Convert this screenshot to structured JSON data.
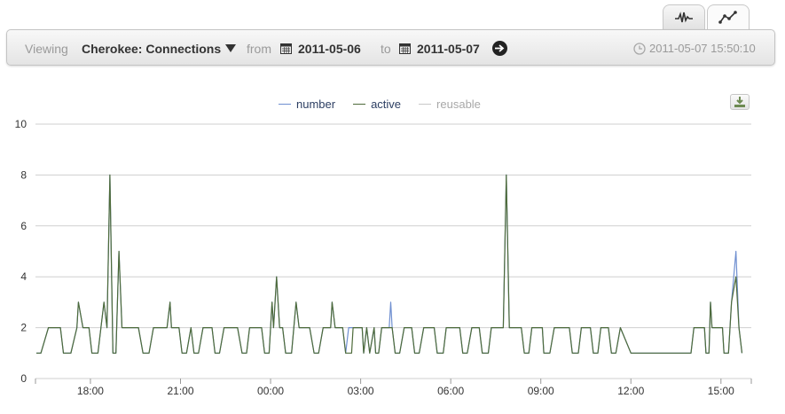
{
  "tabs": [
    {
      "name": "sparkline-tab",
      "icon": "sparkline-icon",
      "active": false
    },
    {
      "name": "line-graph-tab",
      "icon": "line-graph-icon",
      "active": true
    }
  ],
  "toolbar": {
    "viewing_label": "Viewing",
    "source": "Cherokee: Connections",
    "from_label": "from",
    "from_date": "2011-05-06",
    "to_label": "to",
    "to_date": "2011-05-07",
    "timestamp": "2011-05-07 15:50:10"
  },
  "colors": {
    "number": "#6f8fd0",
    "active": "#4e6b3a",
    "reusable": "#c8c8c8",
    "grid": "#cfcfcf"
  },
  "chart_data": {
    "type": "line",
    "ylim": [
      0,
      10
    ],
    "y_ticks": [
      "0",
      "2",
      "4",
      "6",
      "8",
      "10"
    ],
    "x_ticks": [
      "18:00",
      "21:00",
      "00:00",
      "03:00",
      "06:00",
      "09:00",
      "12:00",
      "15:00"
    ],
    "x_tick_hours": [
      18,
      21,
      24,
      27,
      30,
      33,
      36,
      39
    ],
    "x_range_hours": [
      16.17,
      40.01
    ],
    "legend": [
      "number",
      "active",
      "reusable"
    ],
    "active_points": [
      [
        16.2,
        1
      ],
      [
        16.35,
        1
      ],
      [
        16.6,
        2
      ],
      [
        17.0,
        2
      ],
      [
        17.1,
        1
      ],
      [
        17.35,
        1
      ],
      [
        17.55,
        2
      ],
      [
        17.6,
        3
      ],
      [
        17.75,
        2
      ],
      [
        17.95,
        2
      ],
      [
        18.05,
        1
      ],
      [
        18.25,
        1
      ],
      [
        18.35,
        2
      ],
      [
        18.45,
        3
      ],
      [
        18.55,
        2
      ],
      [
        18.65,
        8
      ],
      [
        18.75,
        1
      ],
      [
        18.85,
        1
      ],
      [
        18.95,
        5
      ],
      [
        19.05,
        2
      ],
      [
        19.6,
        2
      ],
      [
        19.75,
        1
      ],
      [
        19.95,
        1
      ],
      [
        20.1,
        2
      ],
      [
        20.55,
        2
      ],
      [
        20.65,
        3
      ],
      [
        20.7,
        2
      ],
      [
        20.95,
        2
      ],
      [
        21.05,
        1
      ],
      [
        21.2,
        1
      ],
      [
        21.35,
        2
      ],
      [
        21.45,
        1
      ],
      [
        21.6,
        1
      ],
      [
        21.75,
        2
      ],
      [
        22.05,
        2
      ],
      [
        22.15,
        1
      ],
      [
        22.3,
        1
      ],
      [
        22.45,
        2
      ],
      [
        22.9,
        2
      ],
      [
        23.05,
        1
      ],
      [
        23.2,
        1
      ],
      [
        23.3,
        2
      ],
      [
        23.7,
        2
      ],
      [
        23.8,
        1
      ],
      [
        23.95,
        1
      ],
      [
        24.05,
        3
      ],
      [
        24.1,
        2
      ],
      [
        24.2,
        4
      ],
      [
        24.3,
        2
      ],
      [
        24.4,
        2
      ],
      [
        24.5,
        1
      ],
      [
        24.7,
        1
      ],
      [
        24.85,
        3
      ],
      [
        24.95,
        2
      ],
      [
        25.3,
        2
      ],
      [
        25.45,
        1
      ],
      [
        25.6,
        1
      ],
      [
        25.75,
        2
      ],
      [
        26.0,
        2
      ],
      [
        26.05,
        3
      ],
      [
        26.15,
        2
      ],
      [
        26.4,
        2
      ],
      [
        26.5,
        1
      ],
      [
        26.7,
        1
      ],
      [
        26.75,
        2
      ],
      [
        27.05,
        2
      ],
      [
        27.1,
        1
      ],
      [
        27.2,
        2
      ],
      [
        27.3,
        1
      ],
      [
        27.45,
        2
      ],
      [
        27.5,
        1
      ],
      [
        27.6,
        1
      ],
      [
        27.7,
        2
      ],
      [
        28.05,
        2
      ],
      [
        28.15,
        1
      ],
      [
        28.3,
        1
      ],
      [
        28.45,
        2
      ],
      [
        28.7,
        2
      ],
      [
        28.8,
        1
      ],
      [
        28.95,
        1
      ],
      [
        29.1,
        2
      ],
      [
        29.45,
        2
      ],
      [
        29.55,
        1
      ],
      [
        29.75,
        1
      ],
      [
        29.85,
        2
      ],
      [
        30.3,
        2
      ],
      [
        30.4,
        1
      ],
      [
        30.55,
        1
      ],
      [
        30.7,
        2
      ],
      [
        30.95,
        2
      ],
      [
        31.05,
        1
      ],
      [
        31.25,
        1
      ],
      [
        31.35,
        2
      ],
      [
        31.75,
        2
      ],
      [
        31.85,
        8
      ],
      [
        31.95,
        2
      ],
      [
        32.35,
        2
      ],
      [
        32.45,
        1
      ],
      [
        32.6,
        1
      ],
      [
        32.7,
        2
      ],
      [
        33.05,
        2
      ],
      [
        33.1,
        1
      ],
      [
        33.3,
        1
      ],
      [
        33.45,
        2
      ],
      [
        33.95,
        2
      ],
      [
        34.05,
        1
      ],
      [
        34.25,
        1
      ],
      [
        34.35,
        2
      ],
      [
        34.65,
        2
      ],
      [
        34.75,
        1
      ],
      [
        34.9,
        1
      ],
      [
        35.0,
        2
      ],
      [
        35.25,
        2
      ],
      [
        35.35,
        1
      ],
      [
        35.5,
        1
      ],
      [
        35.65,
        2
      ],
      [
        36.0,
        1
      ],
      [
        38.0,
        1
      ],
      [
        38.1,
        2
      ],
      [
        38.45,
        2
      ],
      [
        38.5,
        1
      ],
      [
        38.6,
        1
      ],
      [
        38.65,
        3
      ],
      [
        38.7,
        2
      ],
      [
        39.05,
        2
      ],
      [
        39.1,
        1
      ],
      [
        39.25,
        1
      ],
      [
        39.35,
        3
      ],
      [
        39.5,
        4
      ],
      [
        39.6,
        2
      ],
      [
        39.7,
        1
      ]
    ],
    "number_points": [
      [
        16.2,
        1
      ],
      [
        16.35,
        1
      ],
      [
        16.6,
        2
      ],
      [
        17.0,
        2
      ],
      [
        17.1,
        1
      ],
      [
        17.35,
        1
      ],
      [
        17.55,
        2
      ],
      [
        17.6,
        3
      ],
      [
        17.75,
        2
      ],
      [
        17.95,
        2
      ],
      [
        18.05,
        1
      ],
      [
        18.25,
        1
      ],
      [
        18.35,
        2
      ],
      [
        18.45,
        3
      ],
      [
        18.55,
        2
      ],
      [
        18.65,
        8
      ],
      [
        18.75,
        1
      ],
      [
        18.85,
        1
      ],
      [
        18.95,
        5
      ],
      [
        19.05,
        2
      ],
      [
        19.6,
        2
      ],
      [
        19.75,
        1
      ],
      [
        19.95,
        1
      ],
      [
        20.1,
        2
      ],
      [
        20.55,
        2
      ],
      [
        20.65,
        3
      ],
      [
        20.7,
        2
      ],
      [
        20.95,
        2
      ],
      [
        21.05,
        1
      ],
      [
        21.2,
        1
      ],
      [
        21.35,
        2
      ],
      [
        21.45,
        1
      ],
      [
        21.6,
        1
      ],
      [
        21.75,
        2
      ],
      [
        22.05,
        2
      ],
      [
        22.15,
        1
      ],
      [
        22.3,
        1
      ],
      [
        22.45,
        2
      ],
      [
        22.9,
        2
      ],
      [
        23.05,
        1
      ],
      [
        23.2,
        1
      ],
      [
        23.3,
        2
      ],
      [
        23.7,
        2
      ],
      [
        23.8,
        1
      ],
      [
        23.95,
        1
      ],
      [
        24.05,
        3
      ],
      [
        24.1,
        2
      ],
      [
        24.2,
        4
      ],
      [
        24.3,
        2
      ],
      [
        24.4,
        2
      ],
      [
        24.5,
        1
      ],
      [
        24.7,
        1
      ],
      [
        24.85,
        3
      ],
      [
        24.95,
        2
      ],
      [
        25.3,
        2
      ],
      [
        25.45,
        1
      ],
      [
        25.6,
        1
      ],
      [
        25.75,
        2
      ],
      [
        26.0,
        2
      ],
      [
        26.05,
        3
      ],
      [
        26.15,
        2
      ],
      [
        26.4,
        2
      ],
      [
        26.5,
        1
      ],
      [
        26.6,
        2
      ],
      [
        26.75,
        2
      ],
      [
        27.05,
        2
      ],
      [
        27.1,
        1
      ],
      [
        27.2,
        2
      ],
      [
        27.3,
        1
      ],
      [
        27.45,
        2
      ],
      [
        27.5,
        1
      ],
      [
        27.6,
        1
      ],
      [
        27.7,
        2
      ],
      [
        27.95,
        2
      ],
      [
        28.0,
        3
      ],
      [
        28.05,
        2
      ],
      [
        28.15,
        1
      ],
      [
        28.3,
        1
      ],
      [
        28.45,
        2
      ],
      [
        28.7,
        2
      ],
      [
        28.8,
        1
      ],
      [
        28.95,
        1
      ],
      [
        29.1,
        2
      ],
      [
        29.45,
        2
      ],
      [
        29.55,
        1
      ],
      [
        29.75,
        1
      ],
      [
        29.85,
        2
      ],
      [
        30.3,
        2
      ],
      [
        30.4,
        1
      ],
      [
        30.55,
        1
      ],
      [
        30.7,
        2
      ],
      [
        30.95,
        2
      ],
      [
        31.05,
        1
      ],
      [
        31.25,
        1
      ],
      [
        31.35,
        2
      ],
      [
        31.75,
        2
      ],
      [
        31.85,
        8
      ],
      [
        31.95,
        2
      ],
      [
        32.35,
        2
      ],
      [
        32.45,
        1
      ],
      [
        32.6,
        1
      ],
      [
        32.7,
        2
      ],
      [
        33.05,
        2
      ],
      [
        33.1,
        1
      ],
      [
        33.3,
        1
      ],
      [
        33.45,
        2
      ],
      [
        33.95,
        2
      ],
      [
        34.05,
        1
      ],
      [
        34.25,
        1
      ],
      [
        34.35,
        2
      ],
      [
        34.65,
        2
      ],
      [
        34.75,
        1
      ],
      [
        34.9,
        1
      ],
      [
        35.0,
        2
      ],
      [
        35.25,
        2
      ],
      [
        35.35,
        1
      ],
      [
        35.5,
        1
      ],
      [
        35.65,
        2
      ],
      [
        36.0,
        1
      ],
      [
        38.0,
        1
      ],
      [
        38.1,
        2
      ],
      [
        38.45,
        2
      ],
      [
        38.5,
        1
      ],
      [
        38.6,
        1
      ],
      [
        38.65,
        3
      ],
      [
        38.7,
        2
      ],
      [
        39.05,
        2
      ],
      [
        39.1,
        1
      ],
      [
        39.25,
        1
      ],
      [
        39.35,
        3
      ],
      [
        39.5,
        5
      ],
      [
        39.6,
        2
      ],
      [
        39.7,
        1
      ]
    ]
  }
}
